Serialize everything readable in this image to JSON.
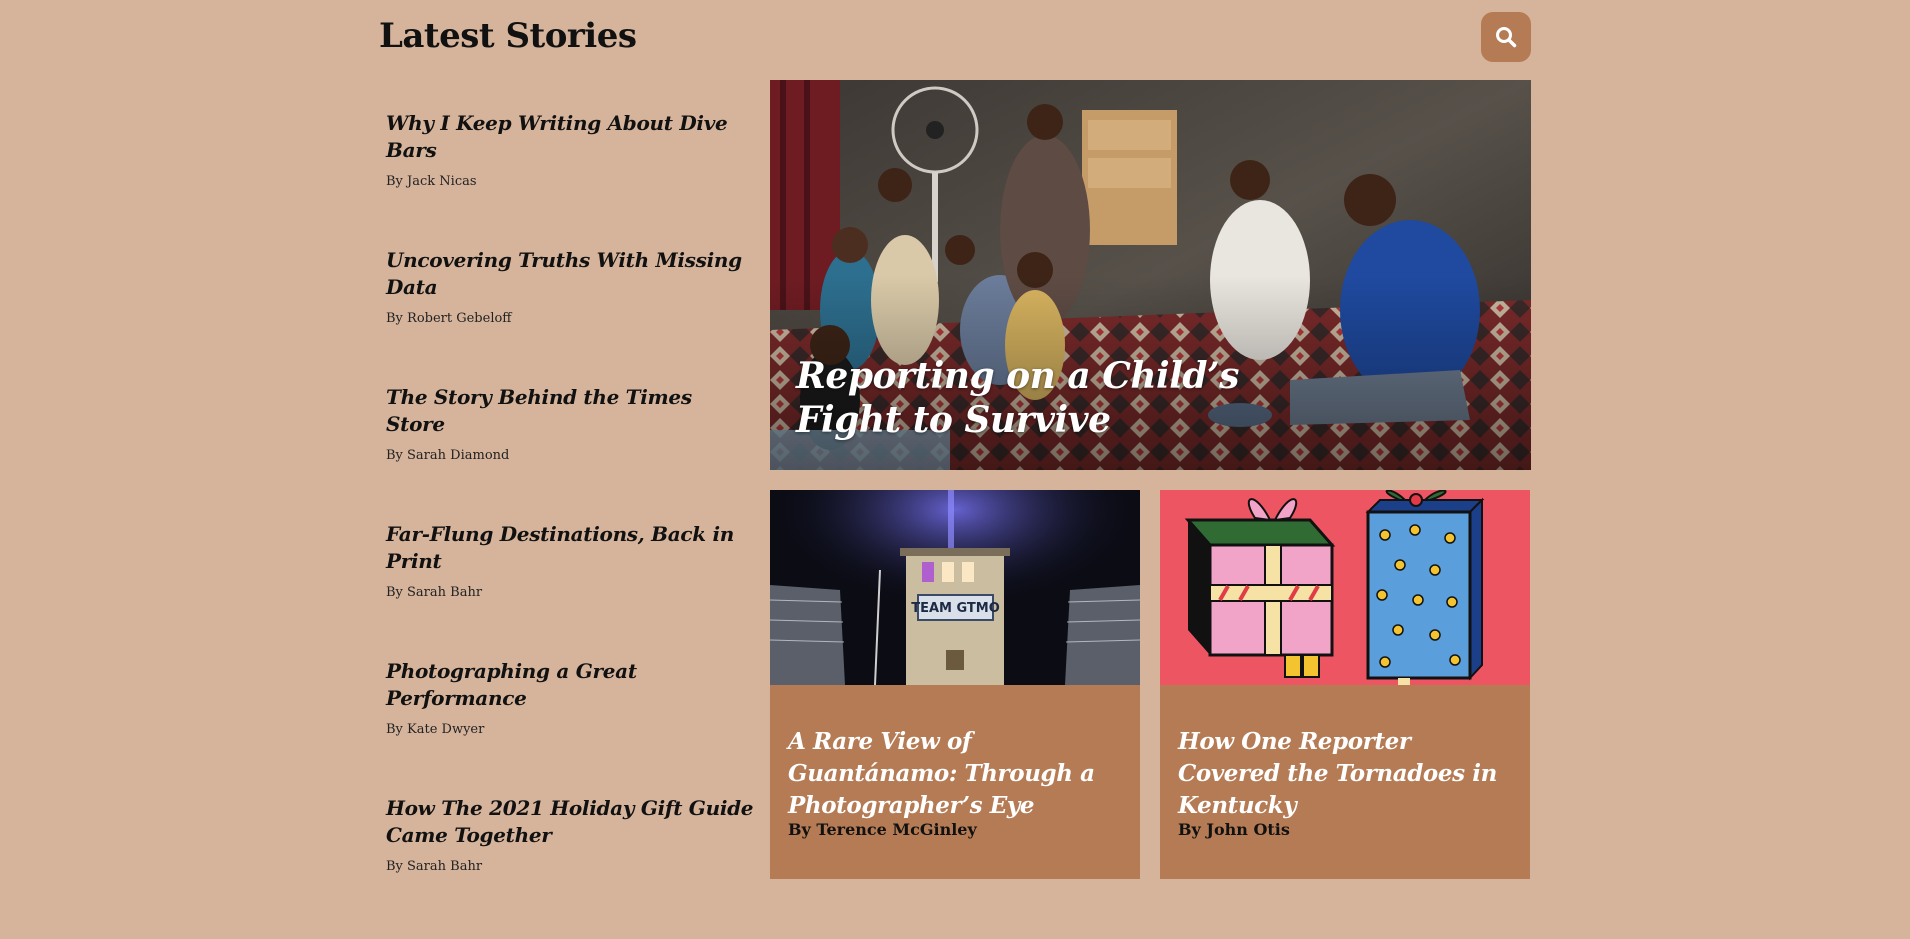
{
  "header": {
    "title": "Latest Stories",
    "search_icon": "search-icon",
    "search_button_color": "#b57b55"
  },
  "stories": [
    {
      "title": "Why I Keep Writing About Dive Bars",
      "byline": "By Jack Nicas"
    },
    {
      "title": "Uncovering Truths With Missing Data",
      "byline": "By Robert Gebeloff"
    },
    {
      "title": "The Story Behind the Times Store",
      "byline": "By Sarah Diamond"
    },
    {
      "title": "Far-Flung Destinations, Back in Print",
      "byline": "By Sarah Bahr"
    },
    {
      "title": "Photographing a Great Performance",
      "byline": "By Kate Dwyer"
    },
    {
      "title": "How The 2021 Holiday Gift Guide Came Together",
      "byline": "By Sarah Bahr"
    }
  ],
  "hero": {
    "title": "Reporting on a Child’s Fight to Survive"
  },
  "cards": [
    {
      "title": "A Rare View of Guantánamo: Through a Photographer’s Eye",
      "byline": "By Terence McGinley",
      "image_sign": "TEAM GTMO"
    },
    {
      "title": "How One Reporter Covered the Tornadoes in Kentucky",
      "byline": "By John Otis"
    }
  ],
  "colors": {
    "background": "#d6b49c",
    "card": "#b57b55",
    "gift_card_background": "#ee5562"
  }
}
